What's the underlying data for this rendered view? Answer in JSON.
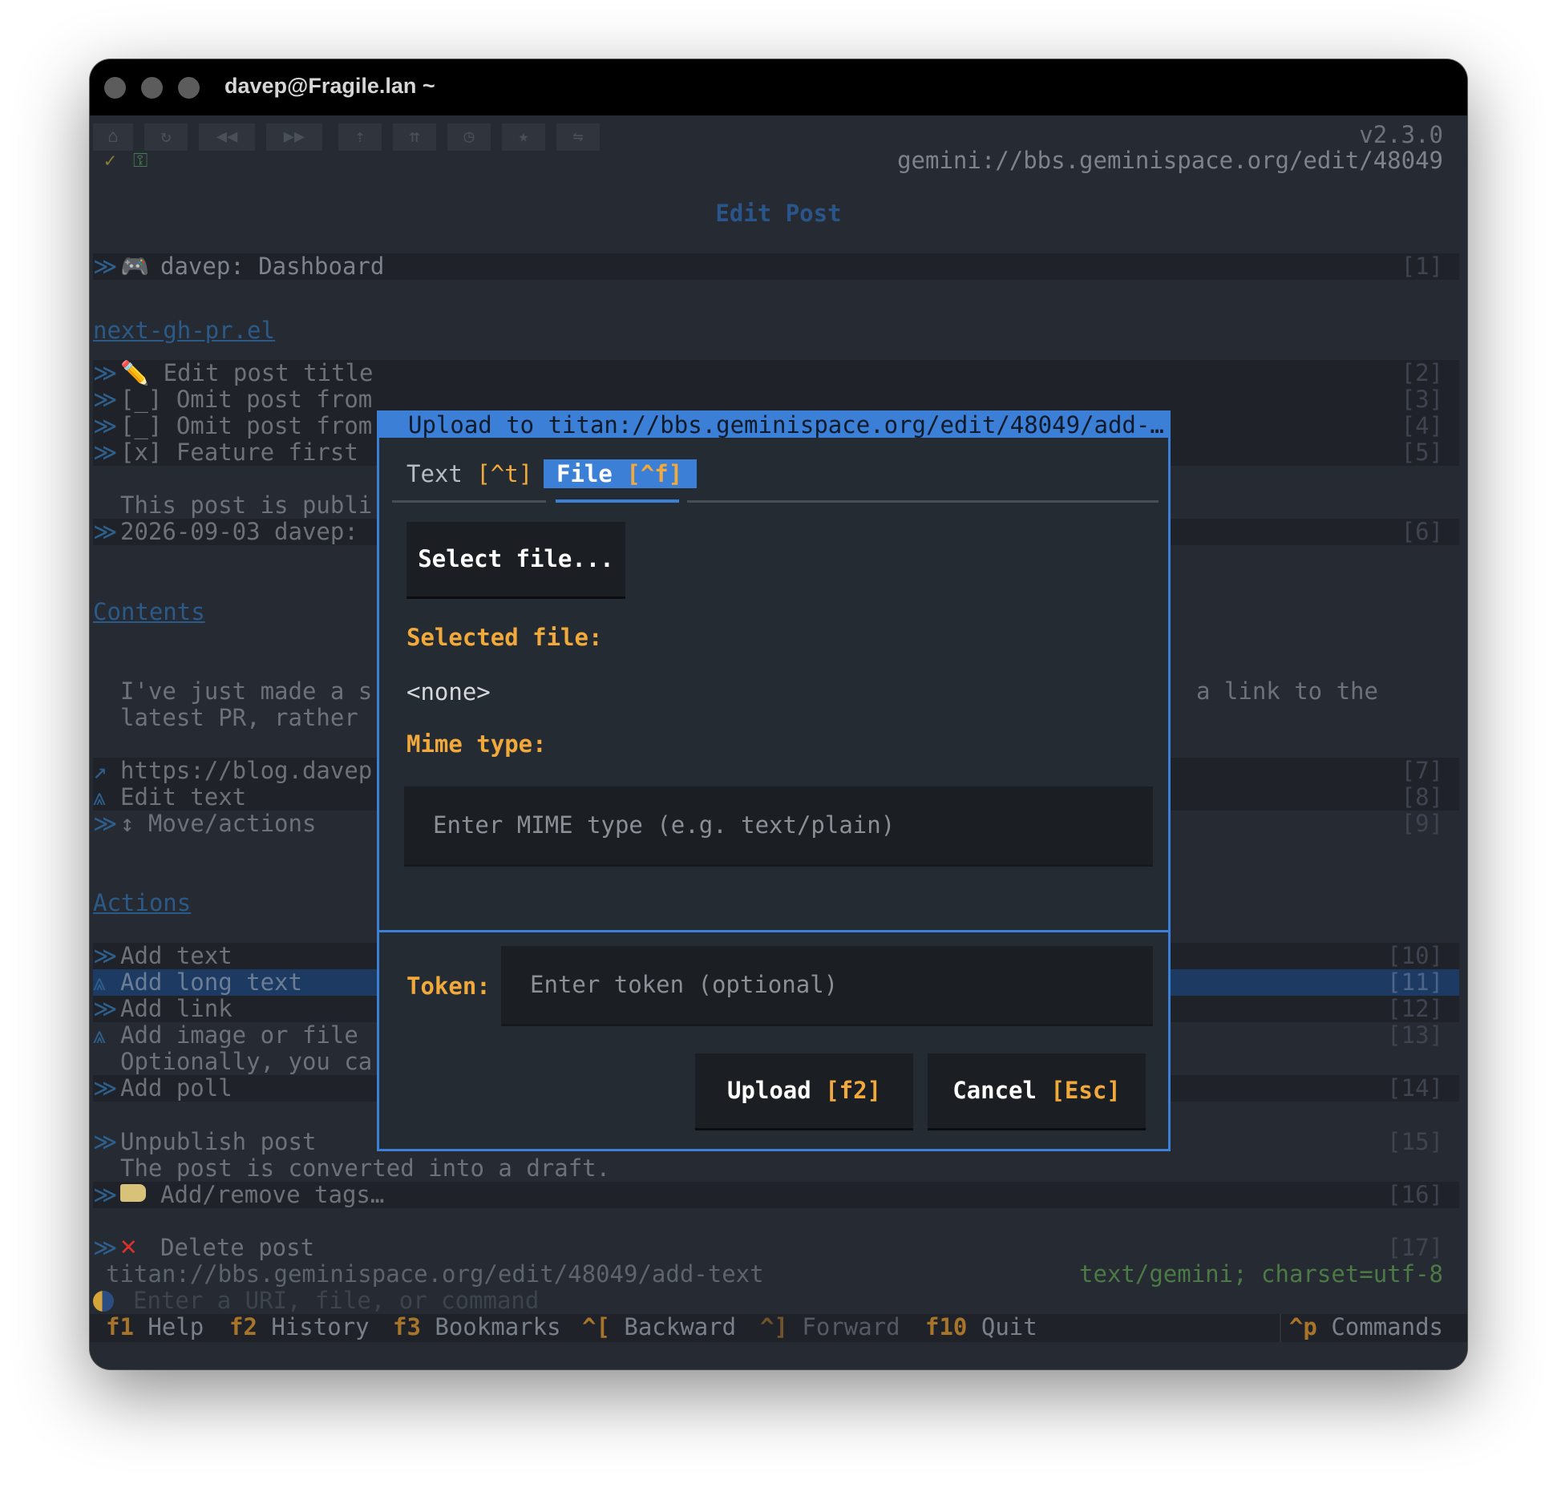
{
  "window": {
    "title": "davep@Fragile.lan ~"
  },
  "toolbar": {
    "buttons": [
      "⌂",
      "↻",
      "◀◀",
      "▶▶",
      "⇡",
      "⇈",
      "◷",
      "★",
      "⇋"
    ],
    "version": "v2.3.0",
    "status_icons": [
      "✓",
      "⚿"
    ],
    "url": "gemini://bbs.geminispace.org/edit/48049"
  },
  "page": {
    "title": "Edit Post",
    "dashboard": {
      "icon": "🎮",
      "label": "davep: Dashboard",
      "num": "[1]"
    },
    "section1_link": "next-gh-pr.el",
    "items1": [
      {
        "text": "✏️ Edit post title",
        "num": "[2]"
      },
      {
        "text": "[_] Omit post from",
        "num": "[3]"
      },
      {
        "text": "[_] Omit post from",
        "num": "[4]"
      },
      {
        "text": "[x] Feature first",
        "num": "[5]"
      }
    ],
    "publish_note": "This post is publi",
    "date_line": {
      "text": "2026-09-03 davep:",
      "num": "[6]"
    },
    "contents_link": "Contents",
    "body_line1_left": "I've just made a s",
    "body_line1_right": "a link to the",
    "body_line2_left": "latest PR, rather",
    "links": [
      {
        "arrow": "↗",
        "text": "https://blog.davep",
        "num": "[7]"
      },
      {
        "arrow": "⩓",
        "text": "Edit text",
        "num": "[8]"
      },
      {
        "arrow": "≫",
        "text": "↕ Move/actions",
        "num": "[9]"
      }
    ],
    "actions_link": "Actions",
    "actions": [
      {
        "arrow": "≫",
        "text": "Add text",
        "num": "[10]"
      },
      {
        "arrow": "⩓",
        "text": "Add long text",
        "num": "[11]"
      },
      {
        "arrow": "≫",
        "text": "Add link",
        "num": "[12]"
      },
      {
        "arrow": "⩓",
        "text": "Add image or file",
        "num": "[13]"
      }
    ],
    "optional_note": "Optionally, you ca",
    "poll": {
      "text": "Add poll",
      "num": "[14]"
    },
    "unpublish": {
      "text": "Unpublish post",
      "num": "[15]"
    },
    "unpublish_note": "The post is converted into a draft.",
    "tags": {
      "text": "Add/remove tags…",
      "num": "[16]"
    },
    "delete": {
      "text": "Delete post",
      "num": "[17]"
    }
  },
  "status": {
    "url": "titan://bbs.geminispace.org/edit/48049/add-text",
    "mime": "text/gemini; charset=utf-8"
  },
  "command": {
    "placeholder": "Enter a URI, file, or command"
  },
  "footer": {
    "keys": [
      {
        "key": "f1",
        "label": "Help"
      },
      {
        "key": "f2",
        "label": "History"
      },
      {
        "key": "f3",
        "label": "Bookmarks"
      },
      {
        "key": "^[",
        "label": "Backward"
      },
      {
        "key": "^]",
        "label": "Forward"
      },
      {
        "key": "f10",
        "label": "Quit"
      }
    ],
    "commands": {
      "key": "^p",
      "label": "Commands"
    }
  },
  "dialog": {
    "title": "Upload to titan://bbs.geminispace.org/edit/48049/add-…",
    "tab_text": {
      "label": "Text",
      "key": "[^t]"
    },
    "tab_file": {
      "label": "File",
      "key": "[^f]"
    },
    "select_file": "Select file...",
    "selected_file_label": "Selected file:",
    "selected_file_value": "<none>",
    "mime_label": "Mime type:",
    "mime_placeholder": "Enter MIME type (e.g. text/plain)",
    "token_label": "Token:",
    "token_placeholder": "Enter token (optional)",
    "upload": {
      "label": "Upload",
      "key": "[f2]"
    },
    "cancel": {
      "label": "Cancel",
      "key": "[Esc]"
    }
  }
}
